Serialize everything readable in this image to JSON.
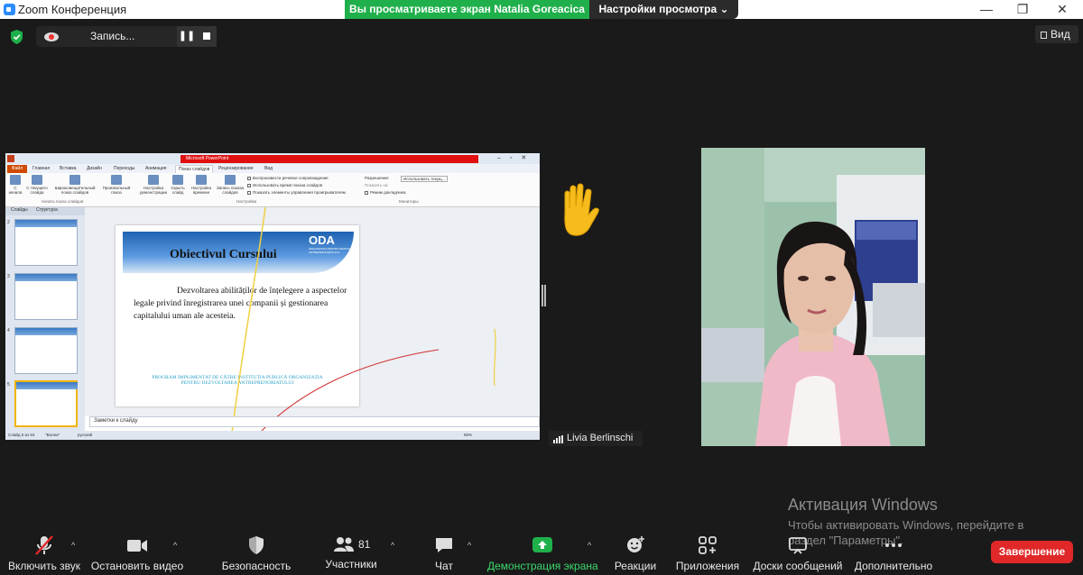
{
  "window": {
    "title": "Zoom Конференция",
    "minimize": "—",
    "restore": "❐",
    "close": "✕"
  },
  "share_banner": {
    "text": "Вы просматриваете экран Natalia Goreacica",
    "view_options": "Настройки просмотра ⌄"
  },
  "recording": {
    "label": "Запись...",
    "pause": "❚❚"
  },
  "view_button": {
    "label": "Вид"
  },
  "shared_screen": {
    "title_bar": "Microsoft PowerPoint",
    "tabs": [
      "Файл",
      "Главная",
      "Вставка",
      "Дизайн",
      "Переходы",
      "Анимация",
      "Показ слайдов",
      "Рецензирование",
      "Вид"
    ],
    "ribbon_buttons": [
      "С начала",
      "С текущего слайда",
      "Широковещательный показ слайдов",
      "Произвольный показ",
      "Настройка демонстрации",
      "Скрыть слайд",
      "Настройка времени",
      "Запись показа слайдов"
    ],
    "ribbon_checks": [
      "Воспроизвести речевое сопровождение",
      "Использовать время показа слайдов",
      "Показать элементы управления проигрывателем"
    ],
    "ribbon_groups": [
      "Начать показ слайдов",
      "Настройка",
      "Мониторы"
    ],
    "monitor_options": [
      "Разрешение:",
      "Использовать текущ...",
      "Показать на:",
      "Режим докладчика"
    ],
    "left_tabs": [
      "Слайды",
      "Структура"
    ],
    "slide": {
      "logo": "ODA",
      "logo_sub": "ORGANIZAȚIA PENTRU DEZVOLTAREA ANTREPRENORIATULUI",
      "title": "Obiectivul Cursului",
      "body": "Dezvoltarea abilităților de înțelegere a aspectelor legale privind înregistrarea unei companii  și gestionarea capitalului uman ale acesteia.",
      "footer_line1": "PROGRAM IMPLIMENTAT DE CĂTRE INSTITUȚIA PUBLICĂ ORGANIZAȚIA",
      "footer_line2": "PENTRU DEZVOLTAREA ANTREPRENORIATULUI"
    },
    "notes_placeholder": "Заметки к слайду",
    "status": {
      "slide_count": "Слайд 5 из 53",
      "theme": "\"Волна\"",
      "language": "русский",
      "zoom": "65%"
    }
  },
  "speaker": {
    "name": "Livia Berlinschi"
  },
  "activation": {
    "title": "Активация Windows",
    "text": "Чтобы активировать Windows, перейдите в раздел \"Параметры\"."
  },
  "toolbar": {
    "unmute": "Включить звук",
    "stop_video": "Остановить видео",
    "security": "Безопасность",
    "participants": "Участники",
    "participants_count": "81",
    "chat": "Чат",
    "share_screen": "Демонстрация экрана",
    "reactions": "Реакции",
    "apps": "Приложения",
    "whiteboards": "Доски сообщений",
    "more": "Дополнительно",
    "end": "Завершение"
  },
  "colors": {
    "share_green": "#1fb04b",
    "end_red": "#e02828",
    "zoom_blue": "#2d8cff"
  }
}
